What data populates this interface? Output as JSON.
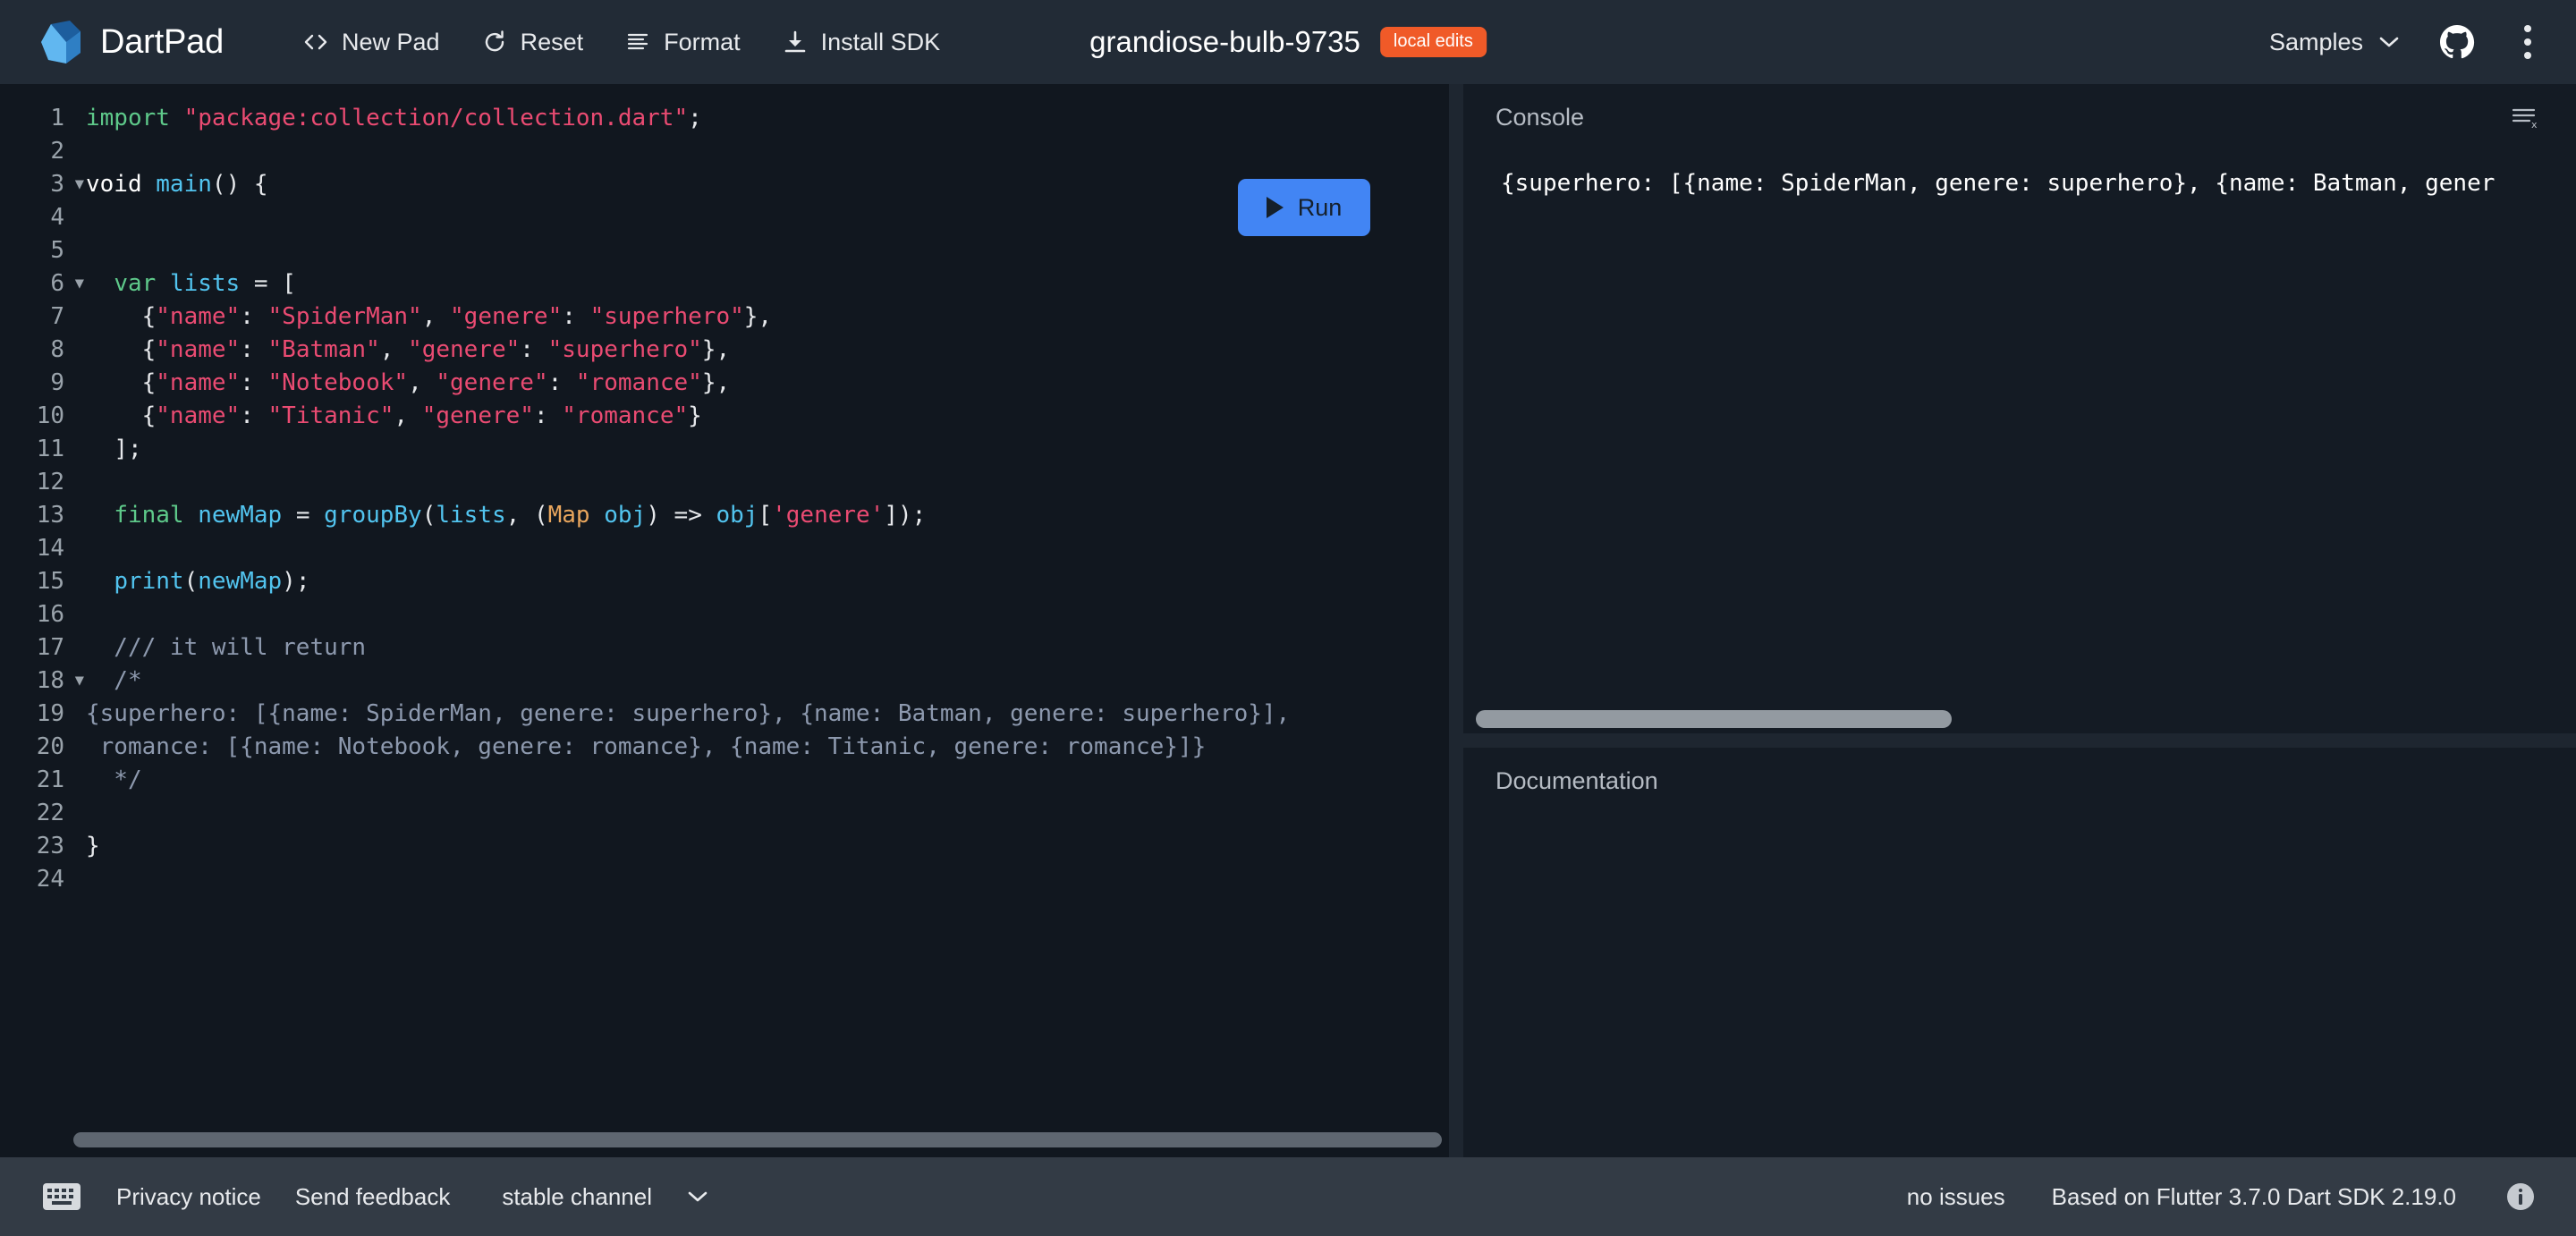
{
  "header": {
    "brand": "DartPad",
    "brand_logo_icon": "dart-logo-icon",
    "toolbar": [
      {
        "label": "New Pad",
        "icon": "code-brackets-icon"
      },
      {
        "label": "Reset",
        "icon": "refresh-icon"
      },
      {
        "label": "Format",
        "icon": "format-lines-icon"
      },
      {
        "label": "Install SDK",
        "icon": "download-icon"
      }
    ],
    "pad_title": "grandiose-bulb-9735",
    "badge": "local edits",
    "badge_color": "#f05a28",
    "samples_label": "Samples",
    "samples_chevron_icon": "chevron-down-icon",
    "github_icon": "github-icon",
    "more_icon": "more-vertical-icon",
    "background_color": "#222b36"
  },
  "editor": {
    "run_button_label": "Run",
    "run_button_color": "#4285f4",
    "run_icon": "play-triangle-icon",
    "line_numbers": [
      "1",
      "2",
      "3",
      "4",
      "5",
      "6",
      "7",
      "8",
      "9",
      "10",
      "11",
      "12",
      "13",
      "14",
      "15",
      "16",
      "17",
      "18",
      "19",
      "20",
      "21",
      "22",
      "23",
      "24"
    ],
    "fold_lines": [
      3,
      6,
      18
    ],
    "fold_icon": "triangle-down-icon",
    "total_lines": 24,
    "code_lines": [
      "import \"package:collection/collection.dart\";",
      "",
      "void main() {",
      "",
      "",
      "  var lists = [",
      "    {\"name\": \"SpiderMan\", \"genere\": \"superhero\"},",
      "    {\"name\": \"Batman\", \"genere\": \"superhero\"},",
      "    {\"name\": \"Notebook\", \"genere\": \"romance\"},",
      "    {\"name\": \"Titanic\", \"genere\": \"romance\"}",
      "  ];",
      "",
      "  final newMap = groupBy(lists, (Map obj) => obj['genere']);",
      "",
      "  print(newMap);",
      "",
      "  /// it will return",
      "  /*",
      "{superhero: [{name: SpiderMan, genere: superhero}, {name: Batman, genere: superhero}],",
      " romance: [{name: Notebook, genere: romance}, {name: Titanic, genere: romance}]}",
      "  */",
      "",
      "}",
      ""
    ],
    "syntax_colors": {
      "keyword": "#5ec98a",
      "string": "#ea4b72",
      "identifier": "#52c4ef",
      "class": "#e9a65d",
      "comment": "#8d99ae",
      "plain": "#e6e8eb"
    },
    "background_color": "#11171f"
  },
  "console": {
    "title": "Console",
    "clear_icon": "clear-console-icon",
    "output": "{superhero: [{name: SpiderMan, genere: superhero}, {name: Batman, gener"
  },
  "documentation": {
    "title": "Documentation",
    "content": ""
  },
  "footer": {
    "keyboard_icon": "keyboard-icon",
    "privacy_label": "Privacy notice",
    "feedback_label": "Send feedback",
    "channel_label": "stable channel",
    "channel_chevron_icon": "chevron-down-icon",
    "issues_label": "no issues",
    "version_label": "Based on Flutter 3.7.0 Dart SDK 2.19.0",
    "info_icon": "info-icon",
    "background_color": "#333b45"
  }
}
